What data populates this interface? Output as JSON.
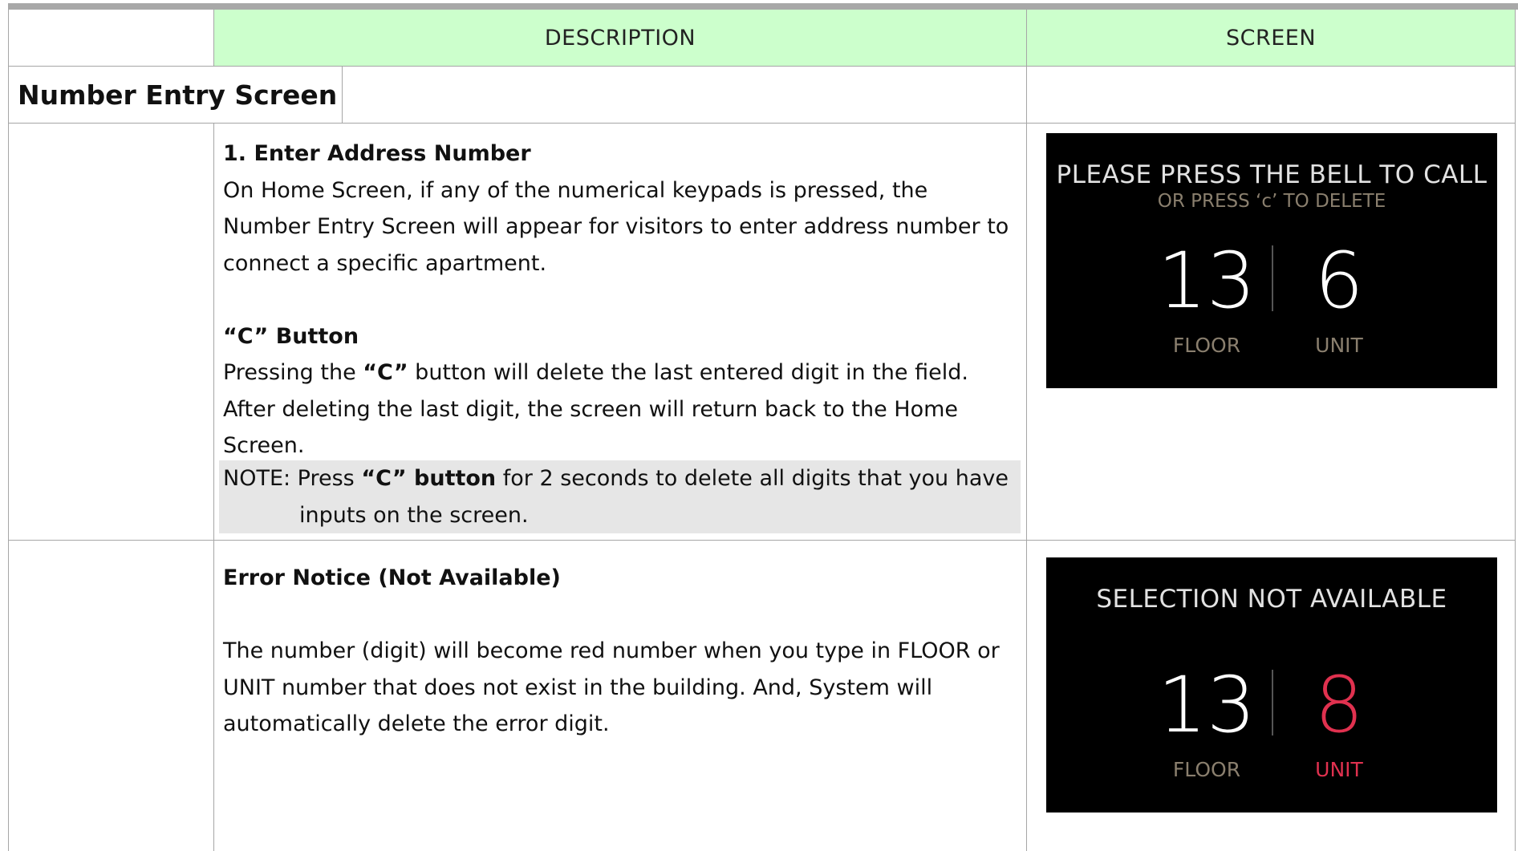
{
  "header": {
    "description": "DESCRIPTION",
    "screen": "SCREEN"
  },
  "section": {
    "title": "Number Entry Screen"
  },
  "row1": {
    "heading": "1. Enter Address Number",
    "para1": "On Home Screen, if any of the numerical keypads is pressed, the Number Entry Screen will appear for visitors to enter address number to connect a specific apartment.",
    "c_heading": "“C” Button",
    "c_para_pre": "Pressing the ",
    "c_para_bold": "“C”",
    "c_para_post": " button will delete the last entered digit in the field. After deleting the last digit, the screen will return back to the Home Screen.",
    "note_pre": "NOTE: Press ",
    "note_bold": "“C” button",
    "note_post": " for 2 seconds to delete all digits that you have",
    "note_line2": "inputs on the screen.",
    "screen": {
      "title": "PLEASE PRESS THE BELL TO CALL",
      "subtitle": "OR PRESS ‘c’ TO DELETE",
      "floor_value": "13",
      "unit_value": "6",
      "floor_label": "FLOOR",
      "unit_label": "UNIT"
    }
  },
  "row2": {
    "heading": "Error Notice (Not Available)",
    "para": "The number (digit) will become red number when you type in FLOOR or UNIT number that does not exist in the building. And, System will automatically delete the error digit.",
    "screen": {
      "title": "SELECTION NOT AVAILABLE",
      "floor_value": "13",
      "unit_value": "8",
      "floor_label": "FLOOR",
      "unit_label": "UNIT",
      "error_color": "#e0314f"
    }
  }
}
